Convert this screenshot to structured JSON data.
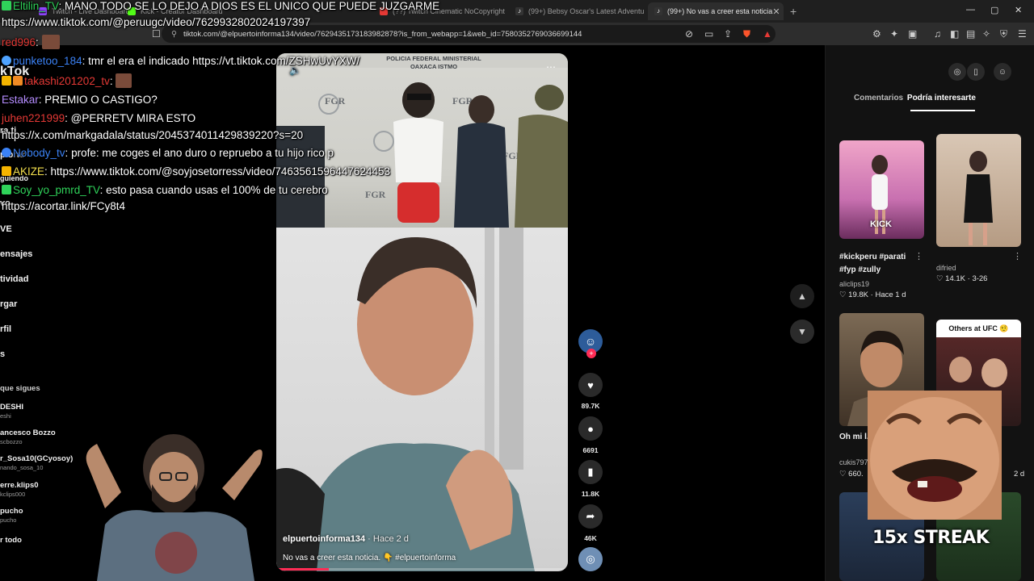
{
  "browser": {
    "tabs": [
      {
        "title": "Twitch - Live Dashboard",
        "active": false,
        "color": "#9146ff"
      },
      {
        "title": "Kick - Creator Dashboard",
        "active": false,
        "color": "#53fc18"
      },
      {
        "title": "(??) Twitch Cinematic NoCopyright",
        "active": false,
        "color": "#e53935"
      },
      {
        "title": "(99+) Bebsy Oscar's Latest Adventure",
        "active": false,
        "color": "#222222"
      },
      {
        "title": "(99+) No vas a creer esta noticia",
        "active": true,
        "color": "#222222"
      }
    ],
    "new_tab": "+",
    "url": "tiktok.com/@elpuertoinforma134/video/7629435173183982878?is_from_webapp=1&web_id=7580352769036699144"
  },
  "left_nav": {
    "logo": "kTok",
    "items": [
      "ra ti",
      "plorar",
      "guiendo",
      "vo",
      "VE",
      "ensajes",
      "tividad",
      "rgar",
      "rfil",
      "s"
    ],
    "following_header": "que sigues",
    "following": [
      {
        "name": "DESHI",
        "handle": "eshi"
      },
      {
        "name": "ancesco Bozzo",
        "handle": "scbozzo"
      },
      {
        "name": "r_Sosa10(GCyosoy)",
        "handle": "nando_sosa_10"
      },
      {
        "name": "erre.klips0",
        "handle": "kclips000"
      },
      {
        "name": "pucho",
        "handle": "pucho"
      }
    ],
    "see_all": "r todo"
  },
  "chat": [
    {
      "user": "Eltilin_TV",
      "message": "MANO TODO SE LO DEJO A DIOS ES EL UNICO QUE PUEDE JUZGARME",
      "color": "#2fd35a"
    },
    {
      "user": "",
      "message": "https://www.tiktok.com/@peruugc/video/7629932802024197397",
      "color": "#ffffff"
    },
    {
      "user": "red996",
      "message": "",
      "color": "#e53935"
    },
    {
      "user": "punketoo_184",
      "message": "tmr el era el indicado https://vt.tiktok.com/ZSHwUvYXW/",
      "color": "#3b82f6"
    },
    {
      "user": "takashi201202_tv",
      "message": "",
      "color": "#e53935"
    },
    {
      "user": "Estakar",
      "message": "PREMIO O CASTIGO?",
      "color": "#b58cff"
    },
    {
      "user": "juhen221999",
      "message": "@PERRETV MIRA ESTO",
      "color": "#e53935"
    },
    {
      "user": "",
      "message": "https://x.com/markgadala/status/2045374011429839220?s=20",
      "color": "#ffffff"
    },
    {
      "user": "Nobody_tv",
      "message": "profe: me coges el ano duro o repruebo a tu hijo rico p",
      "color": "#3b82f6"
    },
    {
      "user": "AKIZE",
      "message": "https://www.tiktok.com/@soyjosetorress/video/7463561596447624453",
      "color": "#ffffff"
    },
    {
      "user": "Soy_yo_pmrd_TV",
      "message": "esto pasa cuando usas el 100% de tu cerebro",
      "color": "#2fd35a"
    },
    {
      "user": "",
      "message": "https://acortar.link/FCy8t4",
      "color": "#ffffff"
    }
  ],
  "video": {
    "banner": "POLICIA FEDERAL MINISTERIAL OAXACA ISTMO",
    "wall_text": "FGR",
    "author": "elpuertoinforma134",
    "posted": "Hace 2 d",
    "description": "No vas a creer esta noticia. 👇 #elpuertoinforma",
    "progress": 0.18,
    "accent": "#fe2c55"
  },
  "actions": {
    "likes": "89.7K",
    "comments": "6691",
    "saves": "11.8K",
    "shares": "46K"
  },
  "right_panel": {
    "tabs": [
      "Comentarios",
      "Podría interesarte"
    ],
    "active_tab": "Podría interesarte",
    "cards": [
      {
        "title": "#kickperu #parati #fyp #zully",
        "author": "aliclips19",
        "likes": "19.8K",
        "date": "Hace 1 d",
        "overlay": "KICK"
      },
      {
        "title": "",
        "author": "difried",
        "likes": "14.1K",
        "date": "3-26",
        "overlay": ""
      },
      {
        "title": "Oh mi l... contact...",
        "author": "cukis797",
        "likes": "660.",
        "date": "",
        "overlay": ""
      },
      {
        "title": "...C ...osis",
        "author": "",
        "likes": "",
        "date": "2 d",
        "overlay": "Others at UFC 🤨"
      }
    ]
  },
  "overlay": {
    "streak": "15x STREAK"
  }
}
